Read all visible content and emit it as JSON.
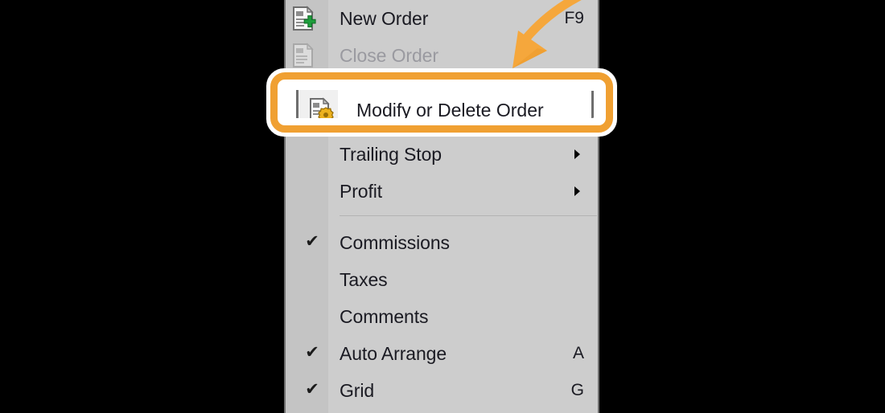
{
  "app": {
    "context_menu_title": "Trading context menu",
    "menu_background": "#cdcdcd",
    "gutter_background": "#c4c4c4",
    "text_color": "#1a1a22",
    "disabled_text_color": "#9a9aa0",
    "highlight_color": "#f0a032",
    "highlight_outline_color": "#ffffff",
    "canvas_background": "#000000"
  },
  "menu": {
    "items": [
      {
        "id": "new-order",
        "label": "New Order",
        "accel": "F9",
        "icon": "document-add-icon",
        "checked": false,
        "submenu": false,
        "disabled": false
      },
      {
        "id": "close-order",
        "label": "Close Order",
        "accel": "",
        "icon": "document-close-icon",
        "checked": false,
        "submenu": false,
        "disabled": true
      },
      {
        "id": "modify-or-delete-order",
        "label": "Modify or Delete Order",
        "accel": "",
        "icon": "document-gear-icon",
        "checked": false,
        "submenu": false,
        "disabled": false
      },
      {
        "id": "trailing-stop",
        "label": "Trailing Stop",
        "accel": "",
        "icon": "",
        "checked": false,
        "submenu": true,
        "disabled": false
      },
      {
        "id": "profit",
        "label": "Profit",
        "accel": "",
        "icon": "",
        "checked": false,
        "submenu": true,
        "disabled": false
      },
      {
        "id": "commissions",
        "label": "Commissions",
        "accel": "",
        "icon": "",
        "checked": true,
        "submenu": false,
        "disabled": false
      },
      {
        "id": "taxes",
        "label": "Taxes",
        "accel": "",
        "icon": "",
        "checked": false,
        "submenu": false,
        "disabled": false
      },
      {
        "id": "comments",
        "label": "Comments",
        "accel": "",
        "icon": "",
        "checked": false,
        "submenu": false,
        "disabled": false
      },
      {
        "id": "auto-arrange",
        "label": "Auto Arrange",
        "accel": "A",
        "icon": "",
        "checked": true,
        "submenu": false,
        "disabled": false
      },
      {
        "id": "grid",
        "label": "Grid",
        "accel": "G",
        "icon": "",
        "checked": true,
        "submenu": false,
        "disabled": false
      }
    ],
    "check_glyph": "✔",
    "separator_after_index": 4
  },
  "callout": {
    "highlighted_item_id": "modify-or-delete-order",
    "highlighted_item_label": "Modify or Delete Order",
    "highlighted_item_icon": "document-gear-icon",
    "arrow_icon": "curved-arrow-icon",
    "arrow_color": "#f0a032"
  }
}
